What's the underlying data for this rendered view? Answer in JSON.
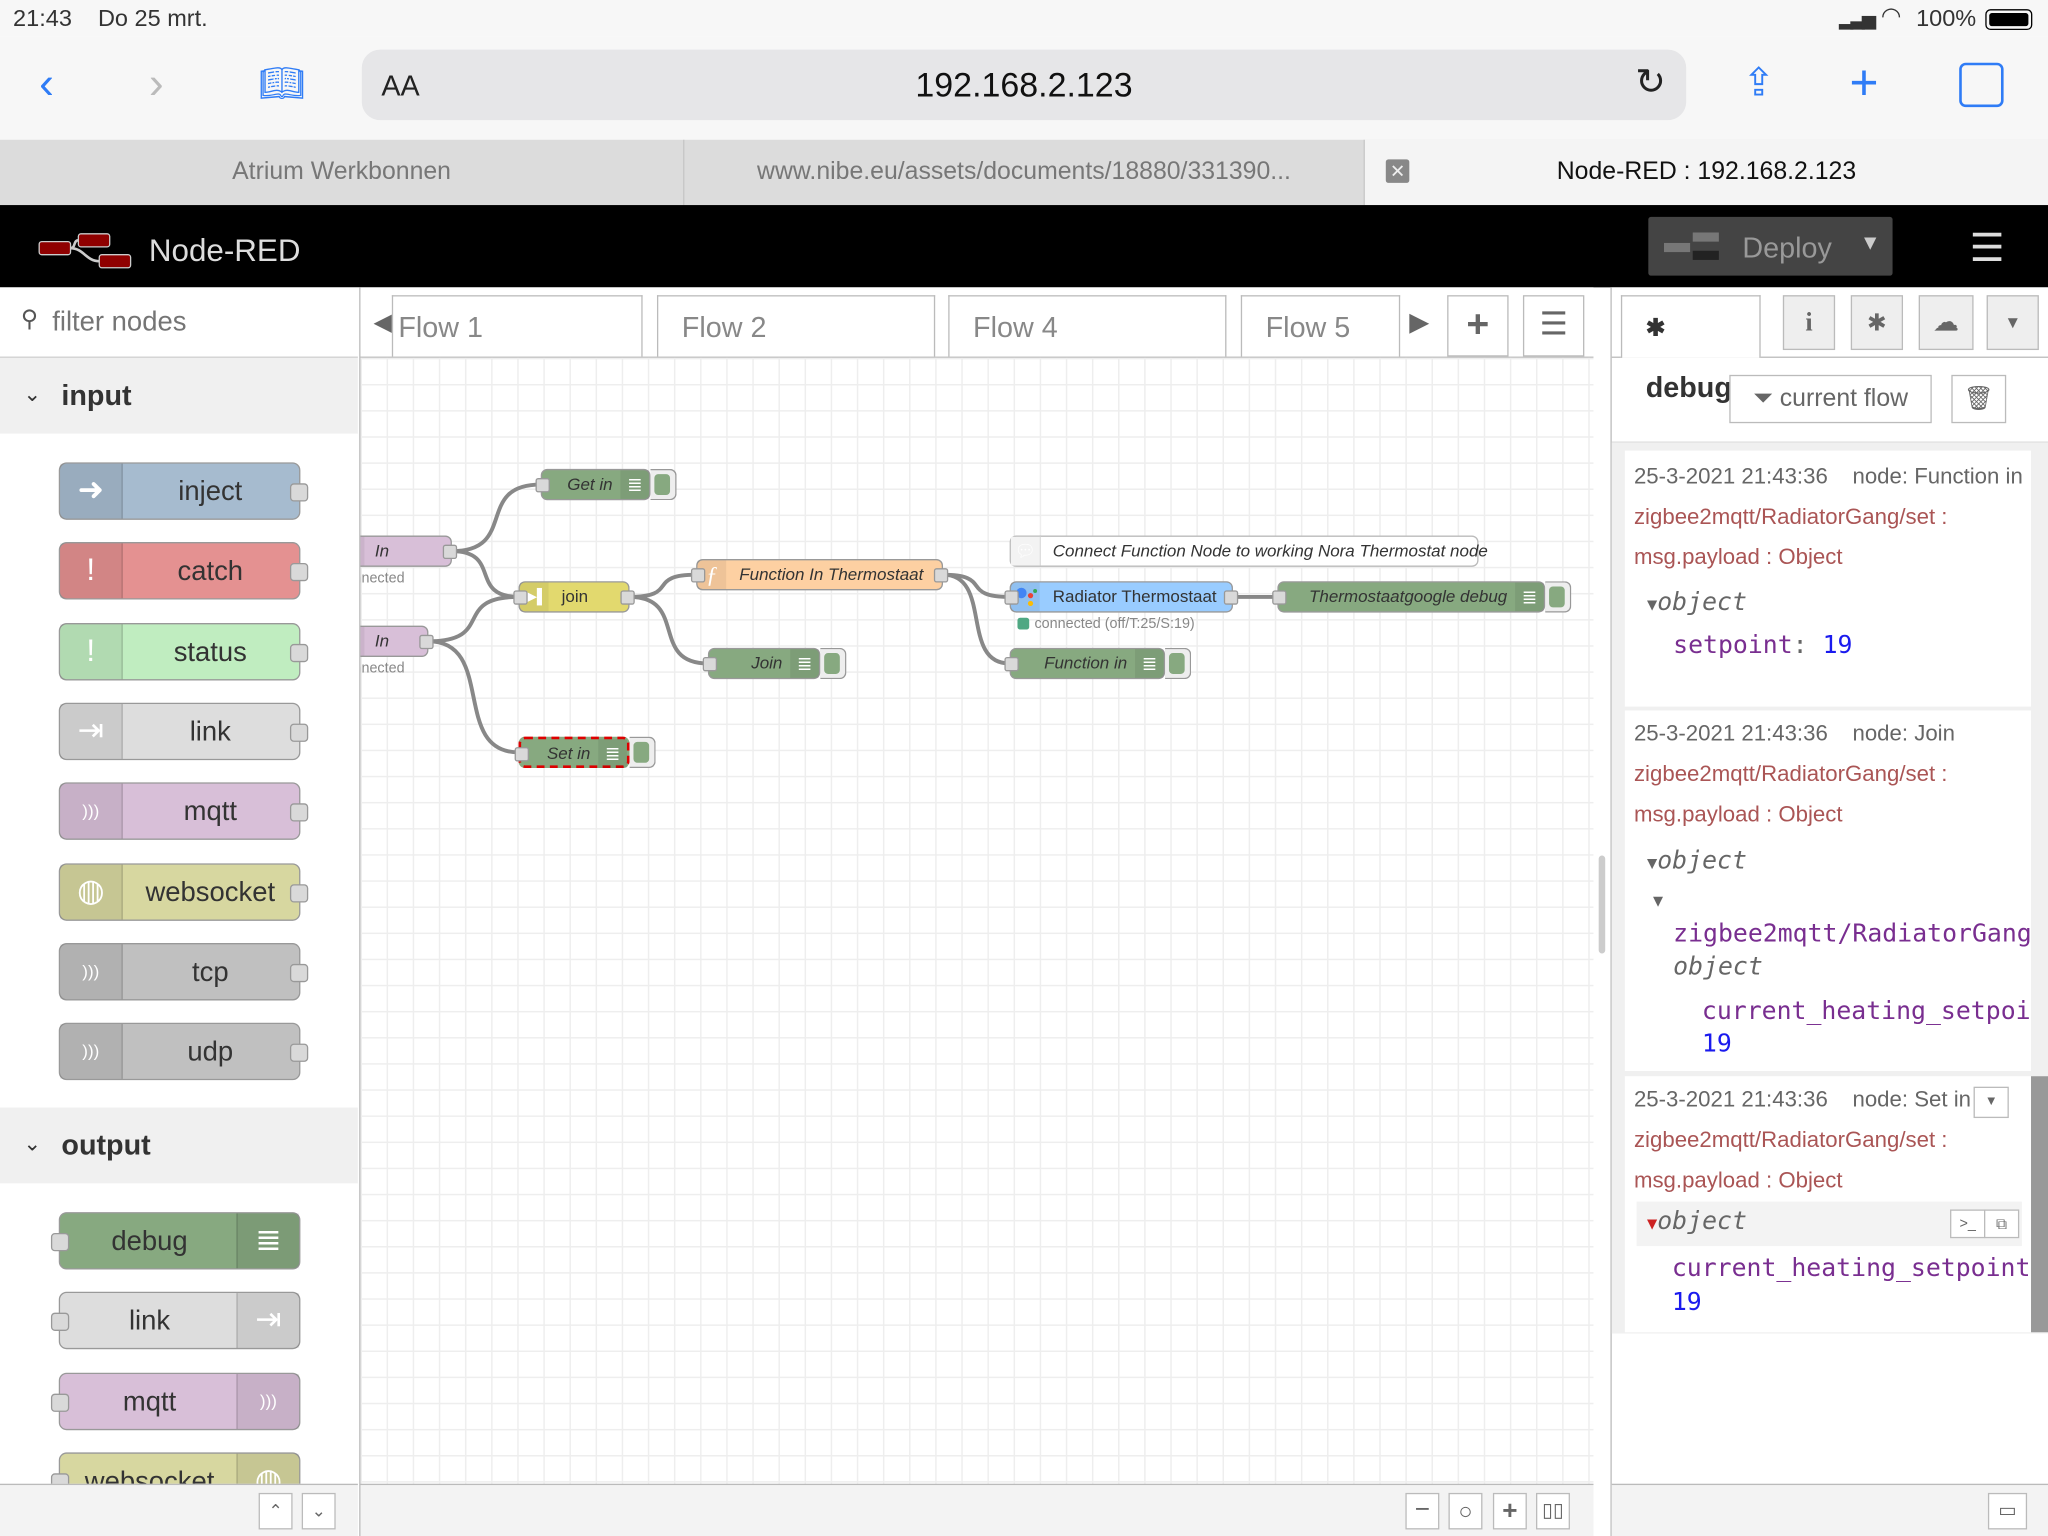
{
  "status_bar": {
    "time": "21:43",
    "date": "Do 25 mrt.",
    "battery": "100%"
  },
  "browser": {
    "url": "192.168.2.123",
    "text_size_label": "AA",
    "tabs": [
      {
        "label": "Atrium Werkbonnen",
        "active": false
      },
      {
        "label": "www.nibe.eu/assets/documents/18880/331390...",
        "active": false
      },
      {
        "label": "Node-RED : 192.168.2.123",
        "active": true
      }
    ]
  },
  "header": {
    "title": "Node-RED",
    "deploy_label": "Deploy"
  },
  "palette": {
    "filter_placeholder": "filter nodes",
    "categories": [
      {
        "label": "input",
        "nodes": [
          {
            "label": "inject",
            "color": "#a6bbcf",
            "icon": "arrow-in-icon"
          },
          {
            "label": "catch",
            "color": "#e49191",
            "icon": "exclamation-icon"
          },
          {
            "label": "status",
            "color": "#c0edc0",
            "icon": "exclamation-icon"
          },
          {
            "label": "link",
            "color": "#dddddd",
            "icon": "link-in-icon"
          },
          {
            "label": "mqtt",
            "color": "#d8bfd8",
            "icon": "bridge-icon"
          },
          {
            "label": "websocket",
            "color": "#d7d7a0",
            "icon": "globe-icon"
          },
          {
            "label": "tcp",
            "color": "#c0c0c0",
            "icon": "bridge-icon"
          },
          {
            "label": "udp",
            "color": "#c0c0c0",
            "icon": "bridge-icon"
          }
        ]
      },
      {
        "label": "output",
        "nodes": [
          {
            "label": "debug",
            "color": "#87a980",
            "icon": "debug-bars-icon"
          },
          {
            "label": "link",
            "color": "#dddddd",
            "icon": "link-out-icon"
          },
          {
            "label": "mqtt",
            "color": "#d8bfd8",
            "icon": "bridge-icon"
          },
          {
            "label": "websocket",
            "color": "#d7d7a0",
            "icon": "globe-icon"
          }
        ]
      }
    ]
  },
  "workspace": {
    "tabs": [
      {
        "label": "Flow 1"
      },
      {
        "label": "Flow 2"
      },
      {
        "label": "Flow 4"
      },
      {
        "label": "Flow 5"
      }
    ],
    "nodes": [
      {
        "id": "in1",
        "label": "In",
        "type": "mqtt-in",
        "color": "#d8bfd8",
        "status": "connected"
      },
      {
        "id": "in2",
        "label": "In",
        "type": "mqtt-in",
        "color": "#d8bfd8",
        "status": "connected"
      },
      {
        "id": "getin",
        "label": "Get in",
        "type": "debug",
        "color": "#87a980"
      },
      {
        "id": "join",
        "label": "join",
        "type": "join",
        "color": "#e2d96e"
      },
      {
        "id": "fn",
        "label": "Function In Thermostaat",
        "type": "function",
        "color": "#fdd0a2"
      },
      {
        "id": "joindbg",
        "label": "Join",
        "type": "debug",
        "color": "#87a980"
      },
      {
        "id": "setin",
        "label": "Set in",
        "type": "debug",
        "color": "#87a980",
        "selected_error": true
      },
      {
        "id": "comment",
        "label": "Connect Function Node to working Nora Thermostat node",
        "type": "comment",
        "color": "#ffffff"
      },
      {
        "id": "radiator",
        "label": "Radiator Thermostaat",
        "type": "nora-thermostat",
        "color": "#99ccff",
        "status": "connected (off/T:25/S:19)",
        "status_color": "#4fa883"
      },
      {
        "id": "tgdbg",
        "label": "Thermostaatgoogle debug",
        "type": "debug",
        "color": "#87a980"
      },
      {
        "id": "fnin",
        "label": "Function in",
        "type": "debug",
        "color": "#87a980"
      }
    ],
    "wires": [
      [
        "in1",
        "getin"
      ],
      [
        "in1",
        "join"
      ],
      [
        "in2",
        "join"
      ],
      [
        "in2",
        "setin"
      ],
      [
        "join",
        "fn"
      ],
      [
        "join",
        "joindbg"
      ],
      [
        "fn",
        "radiator"
      ],
      [
        "fn",
        "fnin"
      ],
      [
        "radiator",
        "tgdbg"
      ]
    ]
  },
  "sidebar": {
    "active_tab": "debug",
    "filter_label": "current flow",
    "messages": [
      {
        "time": "25-3-2021 21:43:36",
        "node": "node: Function in",
        "topic": "zigbee2mqtt/RadiatorGang/set :",
        "payload": "msg.payload : Object",
        "type": "object",
        "key": "setpoint",
        "sep": ":",
        "value": "19"
      },
      {
        "time": "25-3-2021 21:43:36",
        "node": "node: Join",
        "topic": "zigbee2mqtt/RadiatorGang/set :",
        "payload": "msg.payload : Object",
        "type": "object",
        "subkey": "zigbee2mqtt/RadiatorGang",
        "subtype": "object",
        "key": "current_heating_setpoi",
        "value": "19"
      },
      {
        "time": "25-3-2021 21:43:36",
        "node": "node: Set in",
        "topic": "zigbee2mqtt/RadiatorGang/set :",
        "payload": "msg.payload : Object",
        "type": "object",
        "key": "current_heating_setpoint",
        "value": "19"
      }
    ]
  }
}
